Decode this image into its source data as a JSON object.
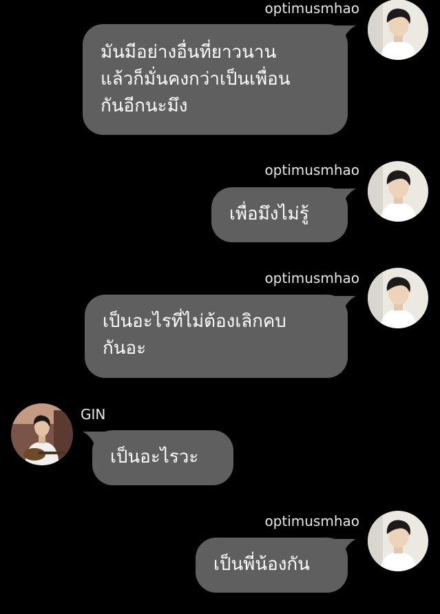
{
  "colors": {
    "background": "#000000",
    "bubble": "#5f5f5f",
    "text": "#ffffff",
    "username": "#e8e8e8"
  },
  "messages": [
    {
      "sender": "optimusmhao",
      "side": "right",
      "text": "มันมีอย่างอื่นที่ยาวนาน\nแล้วก็มั่นคงกว่าเป็นเพื่อน\nกันอีกนะมึง"
    },
    {
      "sender": "optimusmhao",
      "side": "right",
      "text": "เพื่อมึงไม่รู้"
    },
    {
      "sender": "optimusmhao",
      "side": "right",
      "text": "เป็นอะไรที่ไม่ต้องเลิกคบ\nกันอะ"
    },
    {
      "sender": "GIN",
      "side": "left",
      "text": "เป็นอะไรวะ"
    },
    {
      "sender": "optimusmhao",
      "side": "right",
      "text": "เป็นพี่น้องกัน"
    }
  ],
  "icons": {
    "optimusmhao_avatar": "user-avatar-icon",
    "gin_avatar": "user-avatar-icon"
  }
}
